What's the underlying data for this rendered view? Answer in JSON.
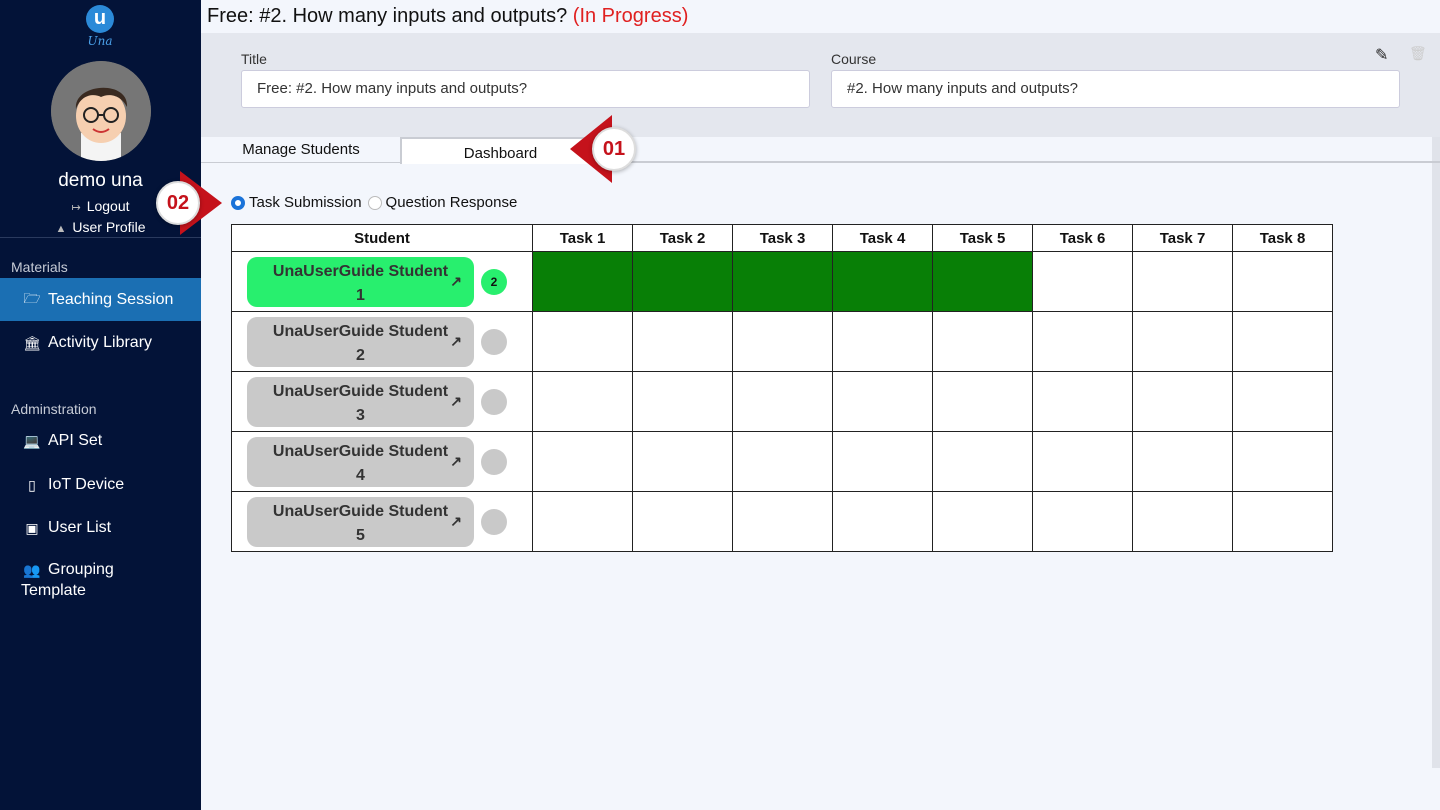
{
  "sidebar": {
    "logo_text": "Una",
    "logo_letter": "u",
    "username": "demo una",
    "logout": "Logout",
    "user_profile": "User Profile",
    "sections": [
      {
        "label": "Materials"
      },
      {
        "label": "Adminstration"
      }
    ],
    "items": [
      {
        "label": "Teaching Session",
        "icon": "folder-open-icon"
      },
      {
        "label": "Activity Library",
        "icon": "bank-icon"
      },
      {
        "label": "API Set",
        "icon": "laptop-icon"
      },
      {
        "label": "IoT Device",
        "icon": "tablet-icon"
      },
      {
        "label": "User List",
        "icon": "contact-book-icon"
      },
      {
        "label": "Grouping",
        "label2": "Template",
        "icon": "users-icon"
      }
    ]
  },
  "header": {
    "title": "Free: #2. How many inputs and outputs?",
    "status": "(In Progress)"
  },
  "form": {
    "title_label": "Title",
    "title_value": "Free: #2. How many inputs and outputs?",
    "course_label": "Course",
    "course_value": "#2. How many inputs and outputs?"
  },
  "tabs": [
    {
      "label": "Manage Students"
    },
    {
      "label": "Dashboard",
      "active": true
    }
  ],
  "view_options": [
    {
      "label": "Task Submission",
      "checked": true
    },
    {
      "label": "Question Response",
      "checked": false
    }
  ],
  "table": {
    "headers": [
      "Student",
      "Task 1",
      "Task 2",
      "Task 3",
      "Task 4",
      "Task 5",
      "Task 6",
      "Task 7",
      "Task 8"
    ],
    "rows": [
      {
        "name": "UnaUserGuide Student",
        "number": "1",
        "badge": "2",
        "active": true,
        "tasks_done": 5
      },
      {
        "name": "UnaUserGuide Student",
        "number": "2",
        "badge": "",
        "active": false,
        "tasks_done": 0
      },
      {
        "name": "UnaUserGuide Student",
        "number": "3",
        "badge": "",
        "active": false,
        "tasks_done": 0
      },
      {
        "name": "UnaUserGuide Student",
        "number": "4",
        "badge": "",
        "active": false,
        "tasks_done": 0
      },
      {
        "name": "UnaUserGuide Student",
        "number": "5",
        "badge": "",
        "active": false,
        "tasks_done": 0
      }
    ]
  },
  "markers": {
    "m1": "01",
    "m2": "02"
  },
  "colors": {
    "sidebar": "#031338",
    "active_nav": "#1b6fb3",
    "status_red": "#e02020",
    "task_done": "#087f06",
    "student_active": "#28ef6e",
    "marker_red": "#c5121b"
  }
}
